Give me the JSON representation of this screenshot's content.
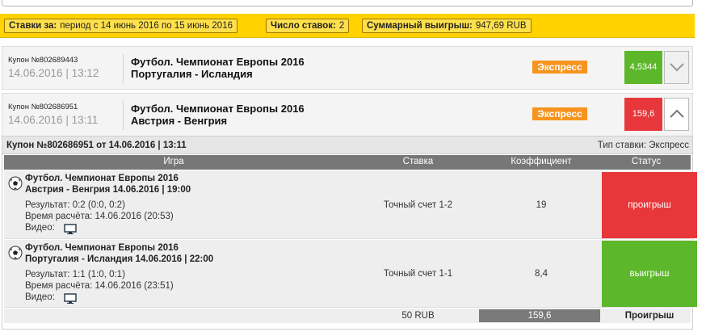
{
  "summary": {
    "period_label": "Ставки за:",
    "period_value": "период с 14 июнь 2016 по 15 июнь 2016",
    "count_label": "Число ставок:",
    "count_value": "2",
    "win_label": "Суммарный выигрыш:",
    "win_value": "947,69 RUB"
  },
  "coupons": [
    {
      "number": "Купон №802689443",
      "datetime": "14.06.2016 | 13:12",
      "title": "Футбол. Чемпионат Европы 2016",
      "match": "Португалия - Исландия",
      "badge": "Экспресс",
      "odds": "4,5344",
      "odds_color": "#5cb82a",
      "toggle_icon": "chevron-down-icon"
    },
    {
      "number": "Купон №802686951",
      "datetime": "14.06.2016 | 13:11",
      "title": "Футбол. Чемпионат Европы 2016",
      "match": "Австрия - Венгрия",
      "badge": "Экспресс",
      "odds": "159,6",
      "odds_color": "#e8373a",
      "toggle_icon": "chevron-up-icon"
    }
  ],
  "details": {
    "header_left": "Купон №802686951 от 14.06.2016 | 13:11",
    "header_right": "Тип ставки: Экспресс",
    "columns": {
      "game": "Игра",
      "bet": "Ставка",
      "coef": "Коэффициент",
      "status": "Статус"
    },
    "rows": [
      {
        "tournament": "Футбол. Чемпионат Европы 2016",
        "match": "Австрия - Венгрия 14.06.2016 | 19:00",
        "result": "Результат: 0:2 (0:0, 0:2)",
        "calc_time": "Время расчёта: 14.06.2016 (20:53)",
        "video_label": "Видео:",
        "bet": "Точный счет 1-2",
        "coef": "19",
        "status": "проигрыш",
        "status_color": "#e8373a"
      },
      {
        "tournament": "Футбол. Чемпионат Европы 2016",
        "match": "Португалия - Исландия 14.06.2016 | 22:00",
        "result": "Результат: 1:1 (1:0, 0:1)",
        "calc_time": "Время расчёта: 14.06.2016 (23:51)",
        "video_label": "Видео:",
        "bet": "Точный счет 1-1",
        "coef": "8,4",
        "status": "выигрыш",
        "status_color": "#5cb82a"
      }
    ],
    "footer": {
      "stake": "50 RUB",
      "total_coef": "159,6",
      "result": "Проигрыш"
    }
  },
  "icons": {
    "ball": "soccer-ball-icon",
    "video": "monitor-icon"
  },
  "colors": {
    "summary_bg": "#ffd200",
    "badge": "#f7941d",
    "win": "#5cb82a",
    "lose": "#e8373a"
  }
}
